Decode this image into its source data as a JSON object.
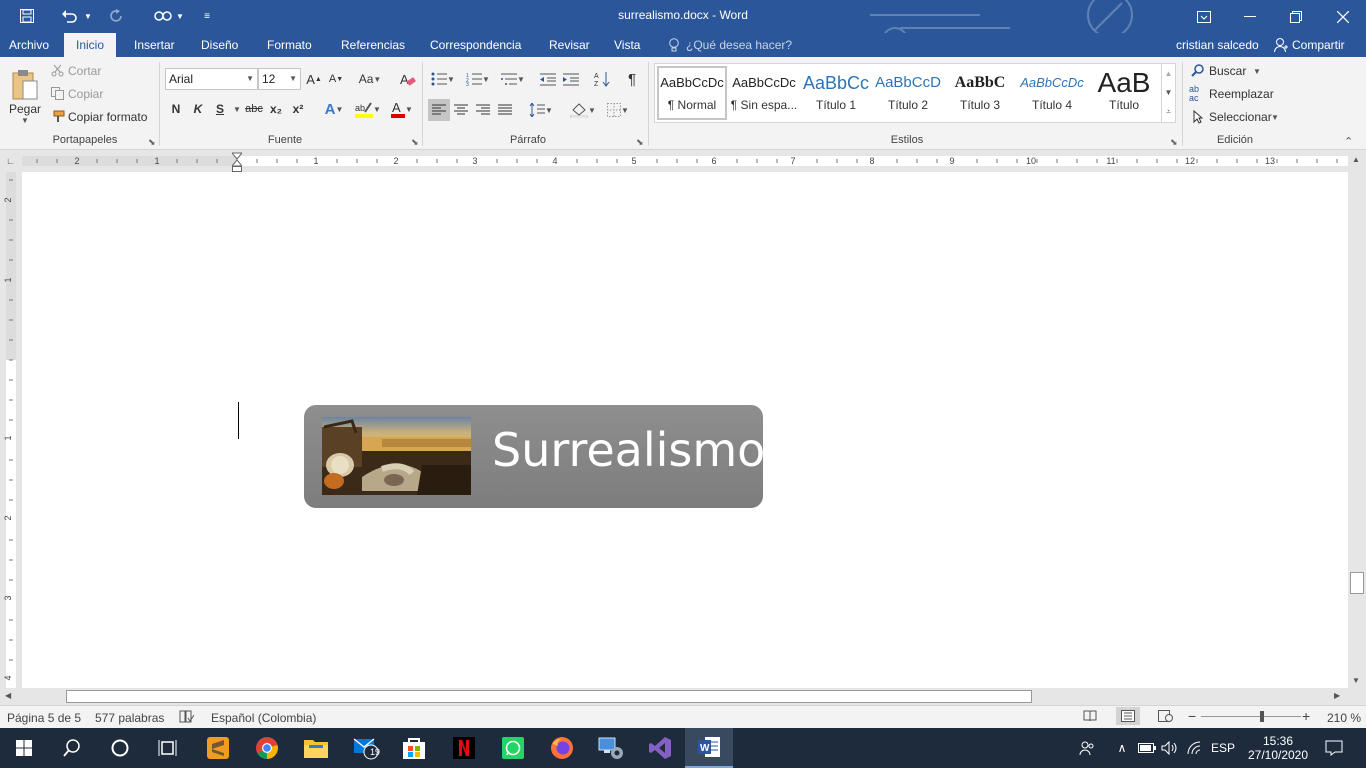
{
  "window": {
    "title": "surrealismo.docx - Word",
    "user": "cristian salcedo",
    "share_label": "Compartir"
  },
  "tabs": [
    "Archivo",
    "Inicio",
    "Insertar",
    "Diseño",
    "Formato",
    "Referencias",
    "Correspondencia",
    "Revisar",
    "Vista"
  ],
  "search_placeholder": "¿Qué desea hacer?",
  "clipboard": {
    "paste": "Pegar",
    "cut": "Cortar",
    "copy": "Copiar",
    "format_painter": "Copiar formato",
    "label": "Portapapeles"
  },
  "font": {
    "name": "Arial",
    "size": "12",
    "label": "Fuente",
    "bold": "N",
    "italic": "K",
    "underline": "S",
    "strike": "abc",
    "sub": "x₂",
    "sup": "x²",
    "change_case": "Aa"
  },
  "paragraph": {
    "label": "Párrafo"
  },
  "styles": {
    "label": "Estilos",
    "items": [
      {
        "sample": "AaBbCcDc",
        "name": "¶ Normal"
      },
      {
        "sample": "AaBbCcDc",
        "name": "¶ Sin espa..."
      },
      {
        "sample": "AaBbCc",
        "name": "Título 1"
      },
      {
        "sample": "AaBbCcD",
        "name": "Título 2"
      },
      {
        "sample": "AaBbC",
        "name": "Título 3"
      },
      {
        "sample": "AaBbCcDc",
        "name": "Título 4"
      },
      {
        "sample": "AaB",
        "name": "Título"
      }
    ]
  },
  "editing": {
    "label": "Edición",
    "find": "Buscar",
    "replace": "Reemplazar",
    "select": "Seleccionar"
  },
  "ruler": {
    "h_ticks": [
      "2",
      "1",
      "1",
      "2",
      "3",
      "4",
      "5",
      "6",
      "7",
      "8",
      "9",
      "10",
      "11",
      "12",
      "13"
    ],
    "v_ticks": [
      "2",
      "1",
      "1",
      "2",
      "3",
      "4"
    ]
  },
  "document": {
    "banner_text": "Surrealismo"
  },
  "status": {
    "page": "Página 5 de 5",
    "words": "577 palabras",
    "language": "Español (Colombia)",
    "zoom": "210 %",
    "zoom_level": 2.1
  },
  "taskbar": {
    "mail_badge": "19",
    "lang": "ESP",
    "time": "15:36",
    "date": "27/10/2020"
  },
  "colors": {
    "accent": "#2b579a",
    "taskbar": "#1e2b3c",
    "banner": "#858585"
  }
}
